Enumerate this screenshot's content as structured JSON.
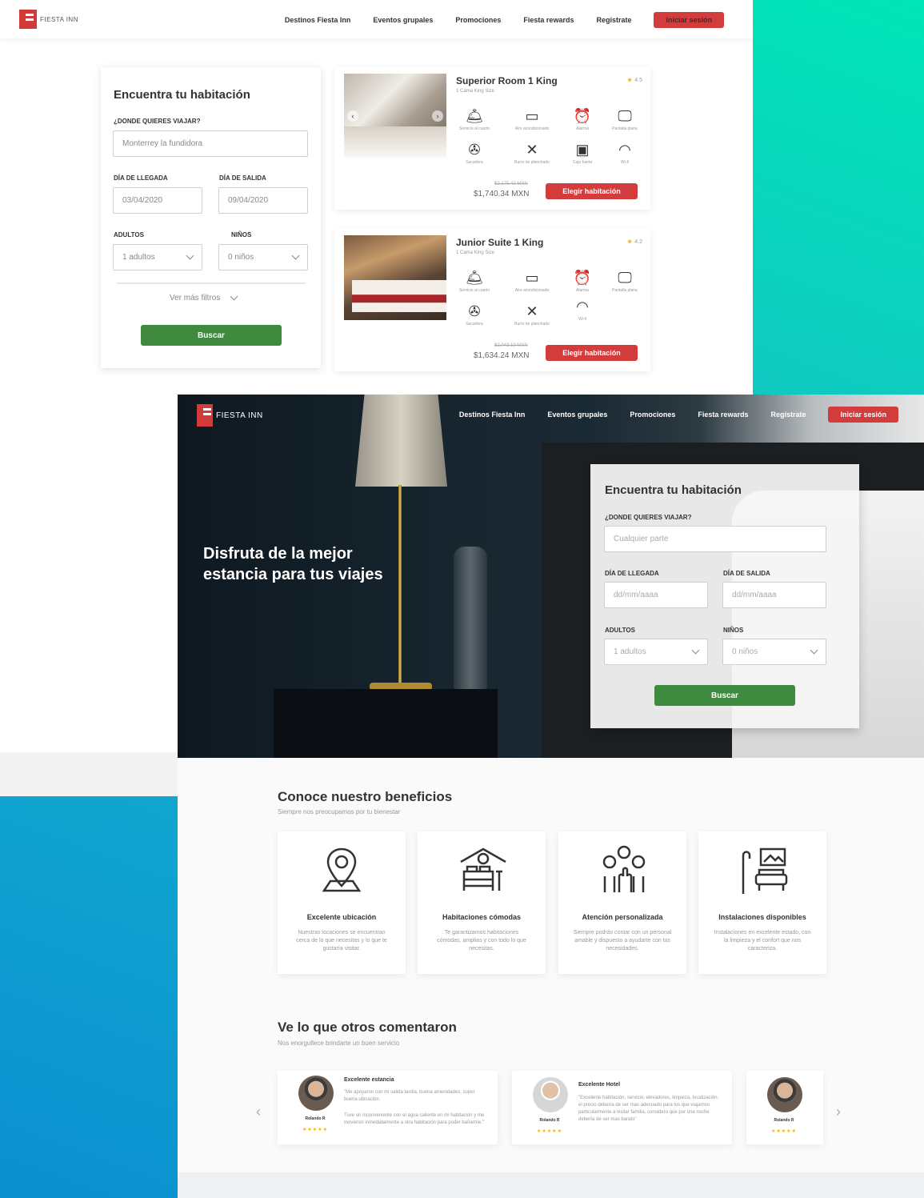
{
  "brand": {
    "name": "FIESTA INN",
    "colors": {
      "red": "#d23c3c",
      "green": "#3f8a3e",
      "star": "#f0b400"
    }
  },
  "nav": {
    "links": [
      "Destinos Fiesta Inn",
      "Eventos grupales",
      "Promociones",
      "Fiesta rewards",
      "Regístrate"
    ],
    "login": "Iniciar sesión"
  },
  "search1": {
    "title": "Encuentra tu habitación",
    "where_label": "¿DONDE QUIERES VIAJAR?",
    "where_value": "Monterrey la fundidora",
    "arrival_label": "DÍA DE LLEGADA",
    "arrival_value": "03/04/2020",
    "departure_label": "DÍA DE SALIDA",
    "departure_value": "09/04/2020",
    "adults_label": "ADULTOS",
    "adults_value": "1 adultos",
    "kids_label": "NIÑOS",
    "kids_value": "0 niños",
    "more_filters": "Ver más filtros",
    "search_button": "Buscar"
  },
  "rooms": [
    {
      "title": "Superior Room 1 King",
      "subtitle": "1 Cama King Size",
      "rating": "4.5",
      "amenities": [
        {
          "icon": "room-service-icon",
          "glyph": "🛎",
          "label": "Servicio al cuarto"
        },
        {
          "icon": "air-conditioner-icon",
          "glyph": "❄",
          "label": "Aire acondicionado"
        },
        {
          "icon": "alarm-icon",
          "glyph": "⏰",
          "label": "Alarma"
        },
        {
          "icon": "tv-icon",
          "glyph": "🖵",
          "label": "Pantalla plana"
        },
        {
          "icon": "hairdryer-icon",
          "glyph": "✇",
          "label": "Secadora"
        },
        {
          "icon": "ironing-icon",
          "glyph": "✕",
          "label": "Burro de planchado"
        },
        {
          "icon": "safe-box-icon",
          "glyph": "▣",
          "label": "Caja fuerte"
        },
        {
          "icon": "wifi-icon",
          "glyph": "◠",
          "label": "Wi-fi"
        }
      ],
      "old_price": "$2,175.42 MXN",
      "price": "$1,740.34 MXN",
      "button": "Elegir habitación"
    },
    {
      "title": "Junior Suite 1 King",
      "subtitle": "1 Cama King Size",
      "rating": "4.2",
      "amenities": [
        {
          "icon": "room-service-icon",
          "glyph": "🛎",
          "label": "Servicio al cuarto"
        },
        {
          "icon": "air-conditioner-icon",
          "glyph": "❄",
          "label": "Aire acondicionado"
        },
        {
          "icon": "alarm-icon",
          "glyph": "⏰",
          "label": "Alarma"
        },
        {
          "icon": "tv-icon",
          "glyph": "🖵",
          "label": "Pantalla plana"
        },
        {
          "icon": "hairdryer-icon",
          "glyph": "✇",
          "label": "Secadora"
        },
        {
          "icon": "ironing-icon",
          "glyph": "✕",
          "label": "Burro de planchado"
        },
        {
          "icon": "wifi-icon",
          "glyph": "◠",
          "label": "Wi-fi"
        }
      ],
      "old_price": "$2,043.10 MXN",
      "price": "$1,634.24 MXN",
      "button": "Elegir habitación"
    }
  ],
  "hero": {
    "headline": "Disfruta de la mejor estancia para tus viajes"
  },
  "search2": {
    "title": "Encuentra tu habitación",
    "where_label": "¿DONDE QUIERES VIAJAR?",
    "where_placeholder": "Cualquier parte",
    "arrival_label": "DÍA DE LLEGADA",
    "arrival_placeholder": "dd/mm/aaaa",
    "departure_label": "DÍA DE SALIDA",
    "departure_placeholder": "dd/mm/aaaa",
    "adults_label": "ADULTOS",
    "adults_value": "1 adultos",
    "kids_label": "NIÑOS",
    "kids_value": "0 niños",
    "search_button": "Buscar"
  },
  "benefits": {
    "title": "Conoce nuestro beneficios",
    "subtitle": "Siempre nos preocupamos por tu bienestar",
    "items": [
      {
        "icon": "location-pin-icon",
        "title": "Excelente ubicación",
        "text": "Nuestras locaciones se encuentran cerca de lo que necesitas y lo que te gustaría visitar."
      },
      {
        "icon": "bedroom-icon",
        "title": "Habitaciones cómodas",
        "text": "Te garantizamos habitaciones cómodas, amplias y con todo lo que necesitas."
      },
      {
        "icon": "personal-attention-icon",
        "title": "Atención personalizada",
        "text": "Siempre podrás contar con un personal amable y dispuesto a ayudarte con tus necesidades."
      },
      {
        "icon": "facilities-icon",
        "title": "Instalaciones disponibles",
        "text": "Instalaciones en excelente estado, con la limpieza y el confort que nos caracteriza."
      }
    ]
  },
  "testimonials": {
    "title": "Ve lo que otros comentaron",
    "subtitle": "Nos enorgullece brindarte un buen servicio",
    "items": [
      {
        "name": "Rolando R",
        "stars": "★★★★★",
        "title": "Excelente estancia",
        "text1": "\"Me apoyaron con mi salida tardía, buena amenidades, super buena ubicación.",
        "text2": "Tuve un inconveniente con el agua caliente en mi habitación y me movieron inmediatamente a otra habitación para poder bañarme.\""
      },
      {
        "name": "Rolando R",
        "stars": "★★★★★",
        "title": "Excelente Hotel",
        "text1": "\"Excelente habitación, servicio, elevadores, limpieza, localización, el precio debería de ser mas adecuado para los que viajamos particularmente a visitar familia, considero que por una noche debería de ser mas barato\"",
        "text2": ""
      },
      {
        "name": "Rolando R",
        "stars": "★★★★★",
        "title": "",
        "text1": "",
        "text2": ""
      }
    ]
  }
}
